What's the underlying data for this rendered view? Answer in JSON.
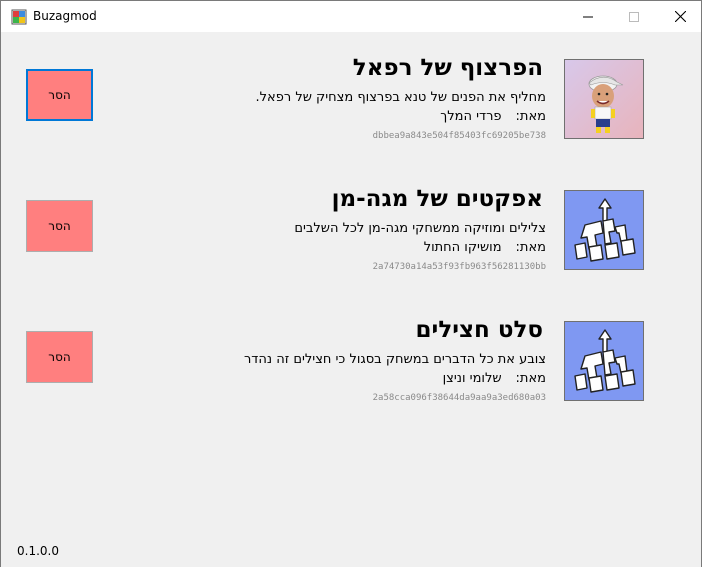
{
  "window": {
    "title": "Buzagmod",
    "version": "0.1.0.0"
  },
  "colors": {
    "remove_button": "#ff7f7f",
    "focus_border": "#0078d7",
    "hash_text": "#8a8a8a",
    "logo_bg": "#7f98f2"
  },
  "author_label": "מאת:",
  "mods": [
    {
      "title": "הפרצוף של רפאל",
      "description": "מחליף את הפנים של טנא בפרצוף מצחיק של רפאל.",
      "author": "פרדי המלך",
      "hash": "dbbea9a843e504f85403fc69205be738",
      "remove_label": "הסר",
      "thumbnail_icon": "cartoon-face-icon"
    },
    {
      "title": "אפקטים של מגה-מן",
      "description": "צלילים ומוזיקה ממשחקי מגה-מן לכל השלבים",
      "author": "מושיקו החתול",
      "hash": "2a74730a14a53f93fb963f56281130bb",
      "remove_label": "הסר",
      "thumbnail_icon": "buzagmod-logo-icon"
    },
    {
      "title": "סלט חצילים",
      "description": "צובע את כל הדברים במשחק בסגול כי חצילים זה נהדר",
      "author": "שלומי וניצן",
      "hash": "2a58cca096f38644da9aa9a3ed680a03",
      "remove_label": "הסר",
      "thumbnail_icon": "buzagmod-logo-icon"
    }
  ]
}
